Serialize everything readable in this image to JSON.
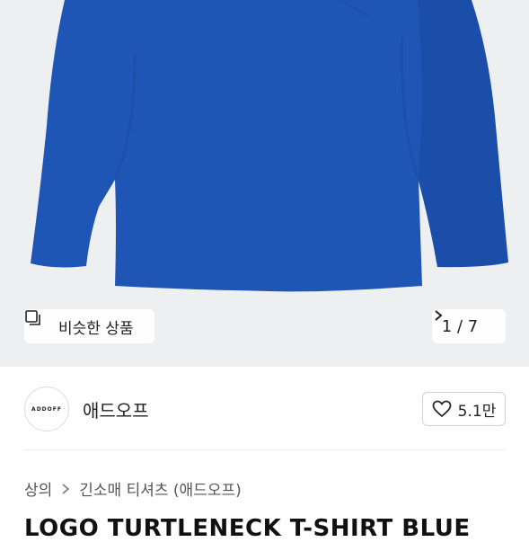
{
  "hero": {
    "similar_label": "비슷한 상품",
    "image_counter": "1 / 7",
    "colors": {
      "background": "#eeeff1",
      "shirt": "#1f56b5"
    }
  },
  "shop": {
    "logo_text": "ADDOFF",
    "name": "애드오프",
    "likes": "5.1만"
  },
  "breadcrumb": {
    "items": [
      "상의",
      "긴소매 티셔츠 (애드오프)"
    ]
  },
  "product": {
    "title": "LOGO TURTLENECK T-SHIRT BLUE"
  }
}
